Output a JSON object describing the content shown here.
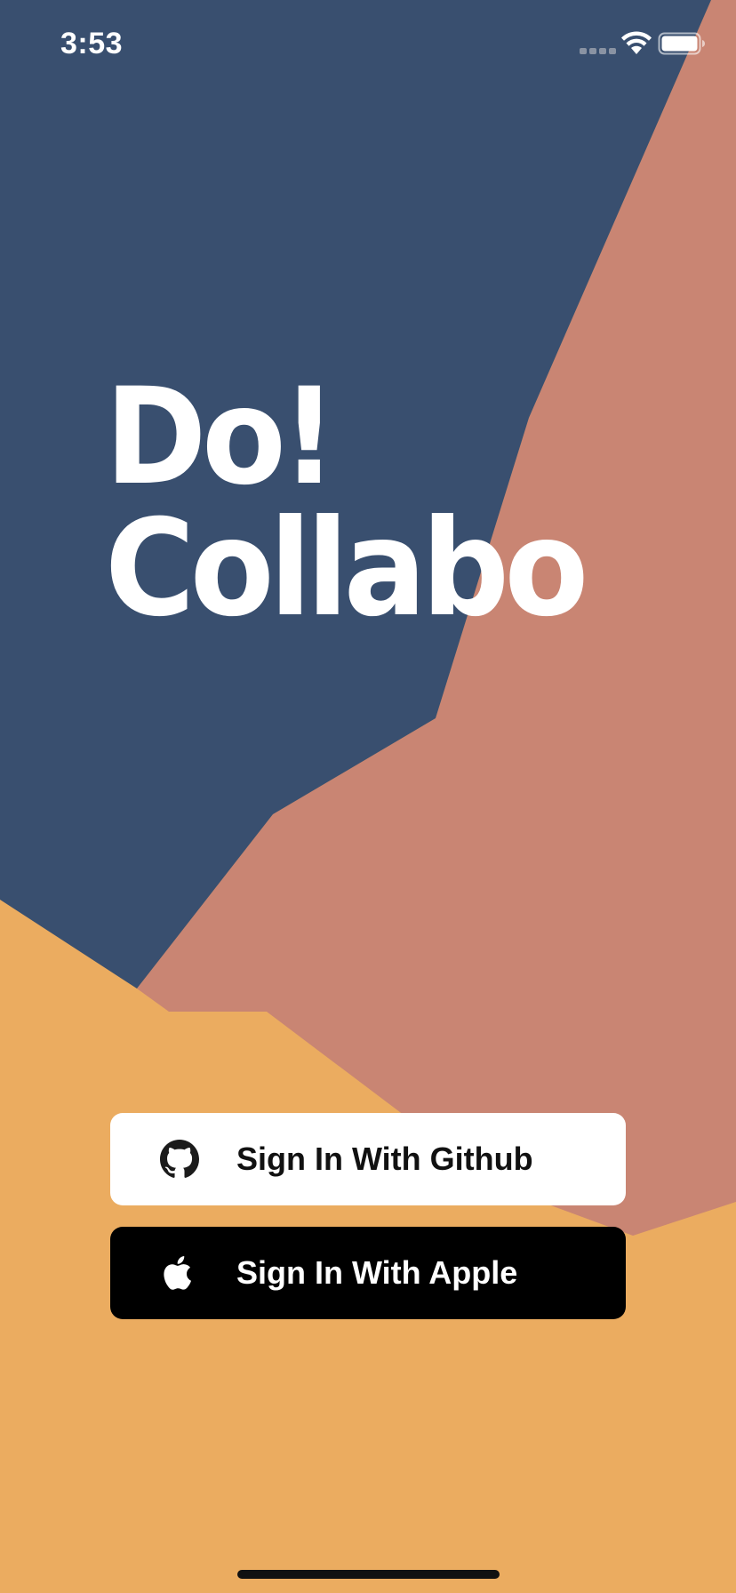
{
  "colors": {
    "navy": "#394F6F",
    "terracotta": "#C98573",
    "orange": "#EBAC60",
    "white": "#FFFFFF",
    "black": "#000000"
  },
  "status_bar": {
    "time": "3:53",
    "signal_icon": "signal-dots-icon",
    "wifi_icon": "wifi-icon",
    "battery_icon": "battery-icon"
  },
  "logo": {
    "line1": "Do!",
    "line2": "Collabo"
  },
  "buttons": {
    "github": {
      "label": "Sign In With Github",
      "icon": "github-icon"
    },
    "apple": {
      "label": "Sign In With Apple",
      "icon": "apple-icon"
    }
  }
}
